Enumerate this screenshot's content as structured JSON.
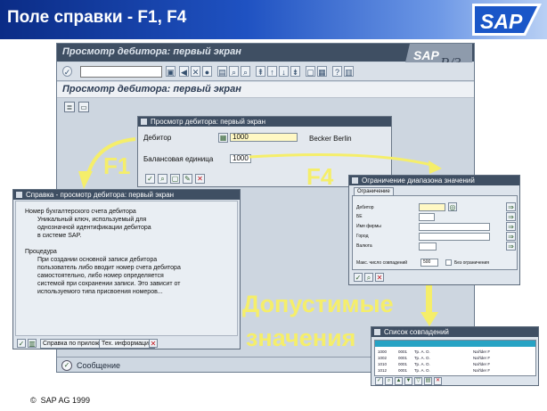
{
  "slide": {
    "title": "Поле справки - F1, F4",
    "logo_text": "SAP"
  },
  "r3": {
    "title": "Просмотр дебитора: первый экран",
    "page_title": "Просмотр дебитора: первый экран",
    "logo_text": "SAP",
    "logo_suffix": "R/3",
    "status_text": "Сообщение"
  },
  "debtor_dialog": {
    "title": "Просмотр дебитора: первый экран",
    "debtor_label": "Дебитор",
    "debtor_value": "1000",
    "debtor_name": "Becker Berlin",
    "company_code_label": "Балансовая единица",
    "company_code_value": "1000"
  },
  "help_dialog": {
    "title": "Справка - просмотр дебитора: первый экран",
    "lines": [
      "Номер бухгалтерского счета дебитора",
      "Уникальный ключ, используемый для",
      "однозначной идентификации дебитора",
      "в системе SAP.",
      "",
      "Процедура",
      "При создании основной записи дебитора",
      "пользователь либо вводит номер счета дебитора",
      "самостоятельно, либо номер определяется",
      "системой при сохранении записи. Это зависит от",
      "используемого типа присвоения номеров..."
    ],
    "btn_tech_help": "Справка по прилож.",
    "btn_tech_info": "Тех. информация"
  },
  "range_dialog": {
    "title": "Ограничение диапазона значений",
    "tab_label": "Ограничение",
    "fields": [
      "Дебитор",
      "БЕ",
      "Имя фирмы",
      "Город",
      "Валюта"
    ],
    "max_hits_label": "Макс. число совпадений",
    "max_hits_value": "500",
    "no_limit_label": "Без ограничения"
  },
  "list_dialog": {
    "title": "Список совпадений",
    "rows": [
      [
        "1000",
        "0001",
        "Тр. А. О.",
        "Nal'lder F"
      ],
      [
        "1002",
        "0001",
        "Тр. А. О.",
        "Nal'lder F"
      ],
      [
        "1010",
        "0001",
        "Тр. А. О.",
        "Nal'lder F"
      ],
      [
        "1012",
        "0001",
        "Тр. А. О.",
        "Nal'lder F"
      ]
    ]
  },
  "labels": {
    "f1": "F1",
    "f4": "F4",
    "allowed_line1": "Допустимые",
    "allowed_line2": "значения",
    "copyright": "SAP AG 1999"
  },
  "colors": {
    "header_dark": "#0b2c86",
    "r3_title": "#3f4f63",
    "accent_yellow": "#f5ee6a",
    "callout_blue": "#1344a8",
    "required_field": "#fff8c4"
  }
}
